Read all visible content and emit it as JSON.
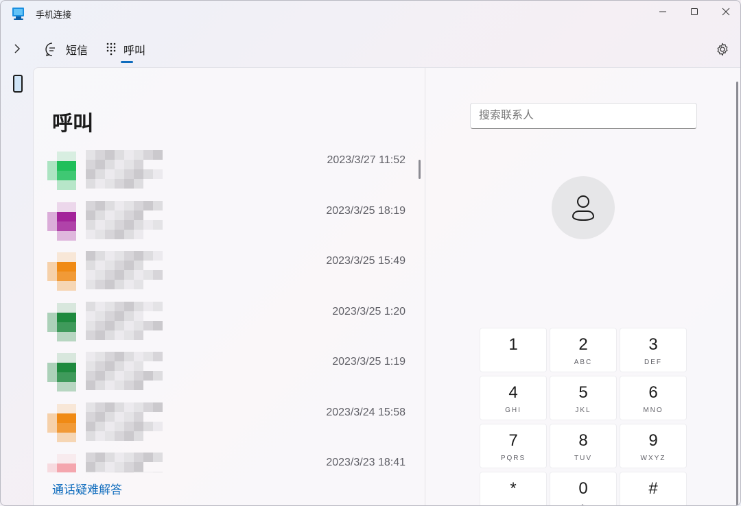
{
  "window": {
    "title": "手机连接"
  },
  "tabs": [
    {
      "label": "短信",
      "icon": "chat-icon"
    },
    {
      "label": "呼叫",
      "icon": "dialpad-icon",
      "selected": true
    }
  ],
  "page": {
    "title": "呼叫",
    "help_link": "通话疑难解答"
  },
  "calls": [
    {
      "time": "2023/3/27 11:52",
      "avatar_color": "#1fbf5a"
    },
    {
      "time": "2023/3/25 18:19",
      "avatar_color": "#a3239a"
    },
    {
      "time": "2023/3/25 15:49",
      "avatar_color": "#f08a14"
    },
    {
      "time": "2023/3/25 1:20",
      "avatar_color": "#1e8a3e"
    },
    {
      "time": "2023/3/25 1:19",
      "avatar_color": "#1e8a3e"
    },
    {
      "time": "2023/3/24 15:58",
      "avatar_color": "#f08a14"
    },
    {
      "time": "2023/3/23 18:41",
      "avatar_color": "#f4a6ae"
    }
  ],
  "search": {
    "placeholder": "搜索联系人"
  },
  "dialpad": [
    {
      "digit": "1",
      "letters": ""
    },
    {
      "digit": "2",
      "letters": "ABC"
    },
    {
      "digit": "3",
      "letters": "DEF"
    },
    {
      "digit": "4",
      "letters": "GHI"
    },
    {
      "digit": "5",
      "letters": "JKL"
    },
    {
      "digit": "6",
      "letters": "MNO"
    },
    {
      "digit": "7",
      "letters": "PQRS"
    },
    {
      "digit": "8",
      "letters": "TUV"
    },
    {
      "digit": "9",
      "letters": "WXYZ"
    },
    {
      "digit": "*",
      "letters": ""
    },
    {
      "digit": "0",
      "letters": "+"
    },
    {
      "digit": "#",
      "letters": ""
    }
  ],
  "colors": {
    "accent": "#0f6cbd"
  }
}
